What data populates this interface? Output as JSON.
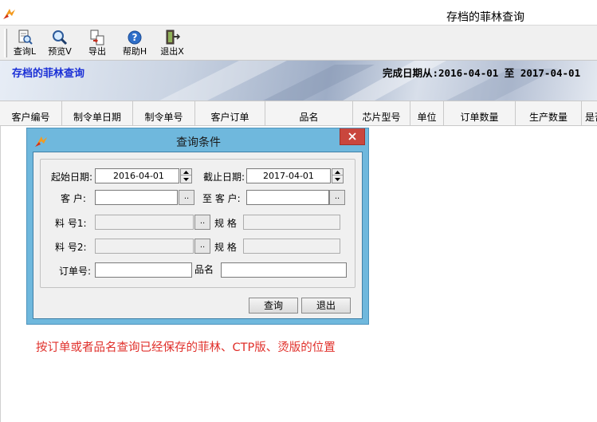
{
  "window": {
    "title": "存档的菲林查询"
  },
  "toolbar": {
    "buttons": [
      {
        "label": "查询L",
        "icon": "query-icon"
      },
      {
        "label": "预览V",
        "icon": "magnifier-icon"
      },
      {
        "label": "导出",
        "icon": "export-icon"
      },
      {
        "label": "帮助H",
        "icon": "help-icon"
      },
      {
        "label": "退出X",
        "icon": "exit-icon"
      }
    ]
  },
  "banner": {
    "title": "存档的菲林查询",
    "range_text": "完成日期从:2016-04-01 至 2017-04-01"
  },
  "grid": {
    "columns": [
      "客户编号",
      "制令单日期",
      "制令单号",
      "客户订单",
      "品名",
      "芯片型号",
      "单位",
      "订单数量",
      "生产数量",
      "是否"
    ]
  },
  "dialog": {
    "title": "查询条件",
    "start_date_label": "起始日期:",
    "start_date": "2016-04-01",
    "end_date_label": "截止日期:",
    "end_date": "2017-04-01",
    "customer_label": "客  户:",
    "customer_from": "",
    "to_customer_label": "至 客 户:",
    "customer_to": "",
    "item1_label": "料  号1:",
    "item2_label": "料  号2:",
    "spec_label": "规  格",
    "order_no_label": "订单号:",
    "product_name_label": "品名",
    "browse_label": "..",
    "query_button": "查询",
    "exit_button": "退出"
  },
  "note": "按订单或者品名查询已经保存的菲林、CTP版、烫版的位置",
  "colors": {
    "banner_title": "#1a2fd6",
    "note": "#e0302b",
    "dialog_frame": "#6fb8dd",
    "close_button": "#c9463d"
  }
}
